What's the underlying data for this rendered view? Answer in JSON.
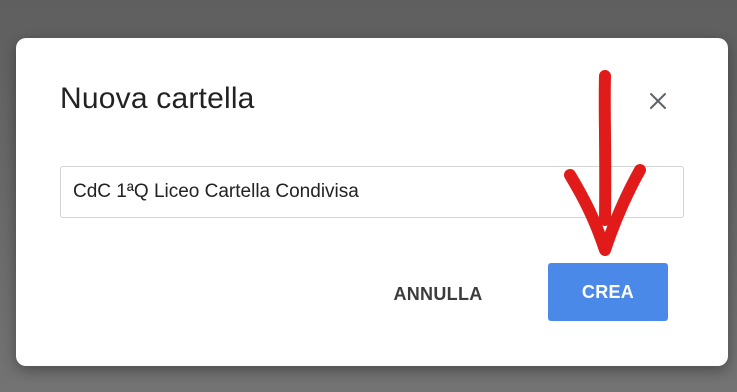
{
  "dialog": {
    "title": "Nuova cartella",
    "close_icon": "close-icon",
    "folder_name_value": "CdC 1ªQ Liceo Cartella Condivisa",
    "cancel_label": "ANNULLA",
    "create_label": "CREA"
  },
  "annotation": {
    "arrow_icon": "red-arrow-down-icon",
    "color": "#e11a1a"
  },
  "colors": {
    "primary_button": "#4a89e8",
    "dialog_background": "#ffffff",
    "overlay": "#6b6b6b"
  }
}
